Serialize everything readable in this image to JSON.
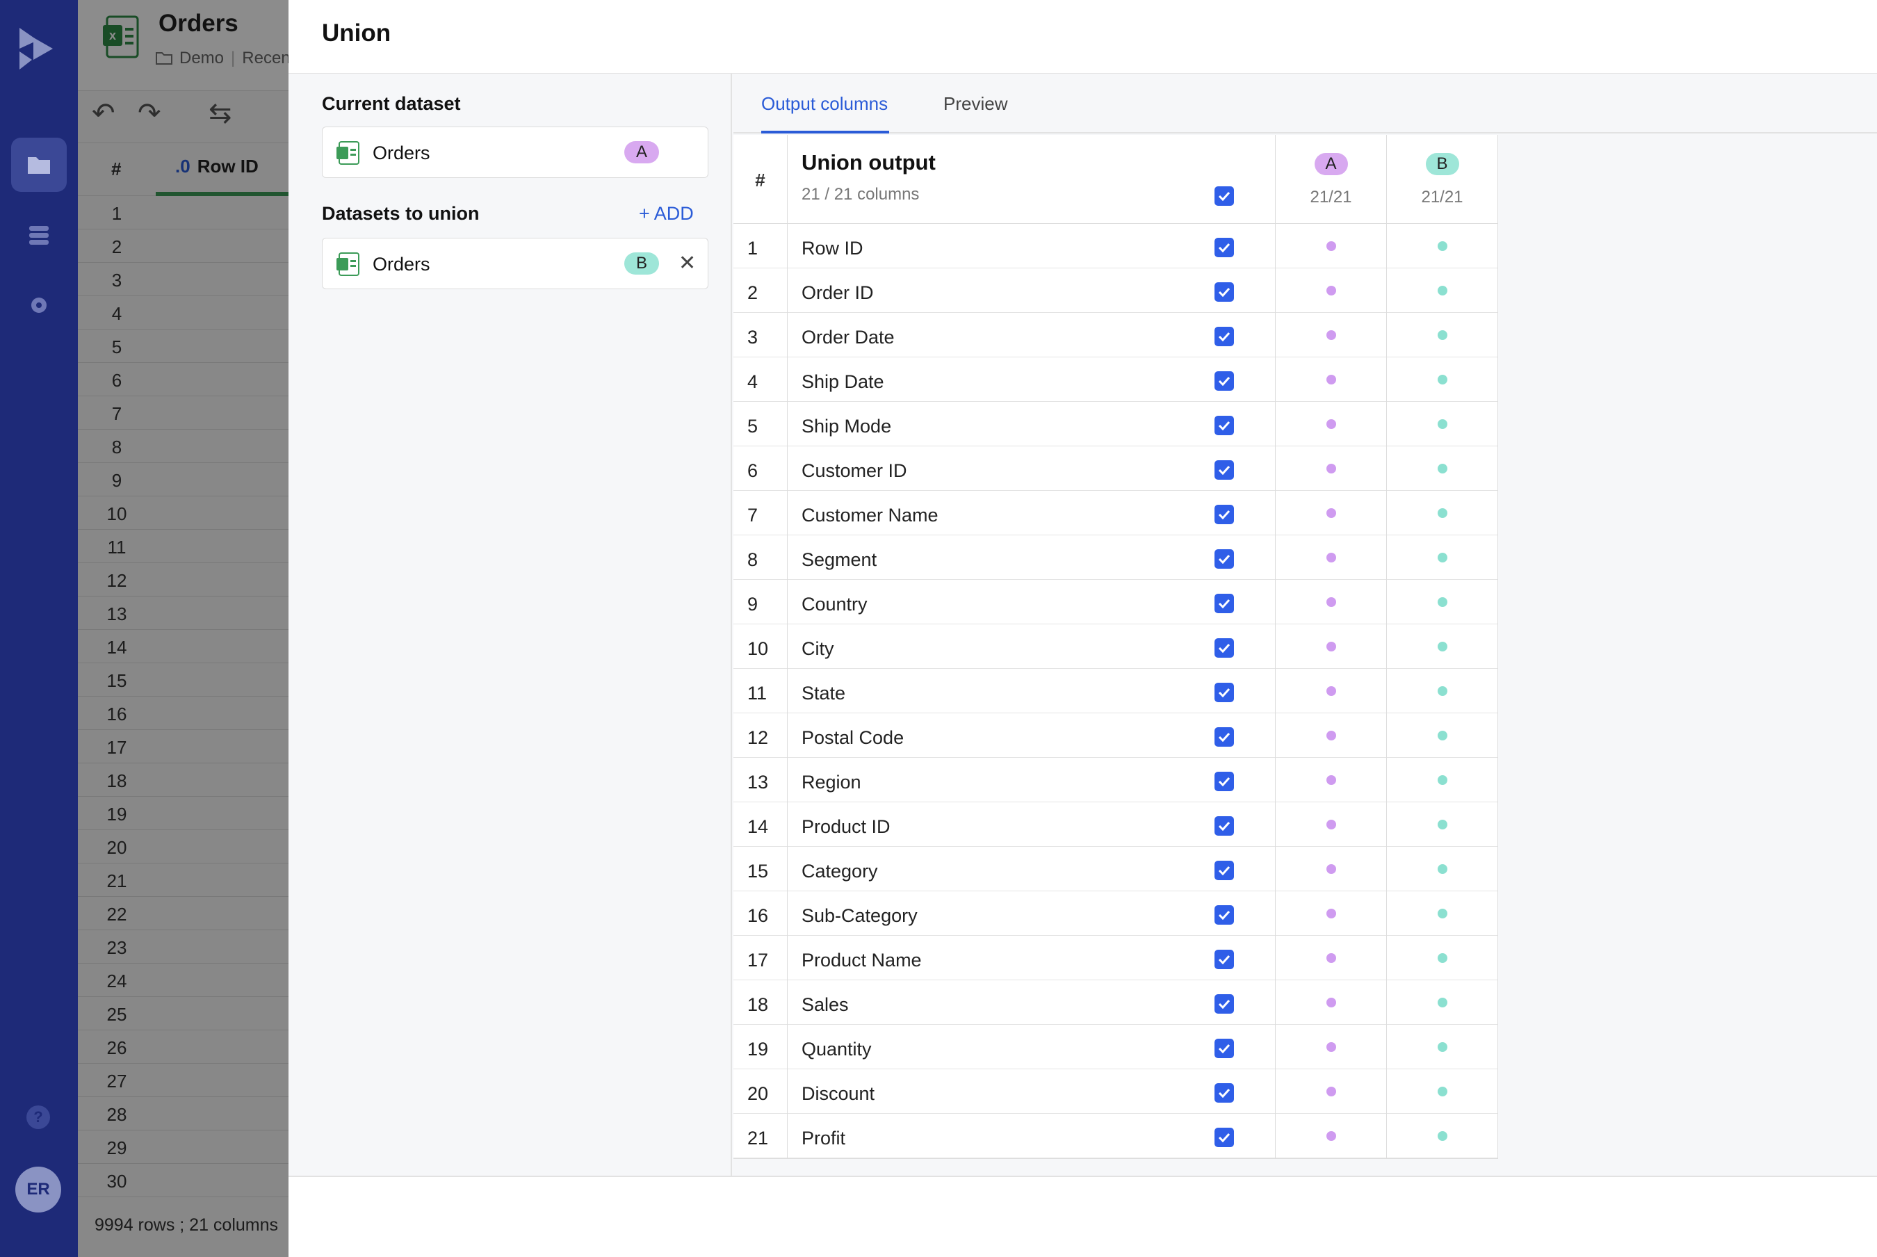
{
  "app": {
    "title": "Orders",
    "breadcrumb_folder": "Demo",
    "breadcrumb_recent": "Recen",
    "grid_first_column": "Row ID",
    "row_numbers": [
      "1",
      "2",
      "3",
      "4",
      "5",
      "6",
      "7",
      "8",
      "9",
      "10",
      "11",
      "12",
      "13",
      "14",
      "15",
      "16",
      "17",
      "18",
      "19",
      "20",
      "21",
      "22",
      "23",
      "24",
      "25",
      "26",
      "27",
      "28",
      "29",
      "30"
    ],
    "status": "9994 rows ; 21 columns",
    "hash": "#"
  },
  "nav": {
    "avatar": "ER",
    "help": "?"
  },
  "modal": {
    "title": "Union",
    "current_dataset_label": "Current dataset",
    "current_dataset": {
      "name": "Orders",
      "badge": "A"
    },
    "datasets_to_union_label": "Datasets to union",
    "add_label": "+ ADD",
    "union_datasets": [
      {
        "name": "Orders",
        "badge": "B"
      }
    ],
    "tabs": [
      {
        "label": "Output columns",
        "active": true
      },
      {
        "label": "Preview",
        "active": false
      }
    ],
    "table": {
      "hash_label": "#",
      "title": "Union output",
      "subtitle": "21 / 21 columns",
      "sources": [
        {
          "badge": "A",
          "count": "21/21",
          "color": "#cf9bf0"
        },
        {
          "badge": "B",
          "count": "21/21",
          "color": "#8be0d0"
        }
      ],
      "columns": [
        {
          "n": "1",
          "name": "Row ID",
          "checked": true
        },
        {
          "n": "2",
          "name": "Order ID",
          "checked": true
        },
        {
          "n": "3",
          "name": "Order Date",
          "checked": true
        },
        {
          "n": "4",
          "name": "Ship Date",
          "checked": true
        },
        {
          "n": "5",
          "name": "Ship Mode",
          "checked": true
        },
        {
          "n": "6",
          "name": "Customer ID",
          "checked": true
        },
        {
          "n": "7",
          "name": "Customer Name",
          "checked": true
        },
        {
          "n": "8",
          "name": "Segment",
          "checked": true
        },
        {
          "n": "9",
          "name": "Country",
          "checked": true
        },
        {
          "n": "10",
          "name": "City",
          "checked": true
        },
        {
          "n": "11",
          "name": "State",
          "checked": true
        },
        {
          "n": "12",
          "name": "Postal Code",
          "checked": true
        },
        {
          "n": "13",
          "name": "Region",
          "checked": true
        },
        {
          "n": "14",
          "name": "Product ID",
          "checked": true
        },
        {
          "n": "15",
          "name": "Category",
          "checked": true
        },
        {
          "n": "16",
          "name": "Sub-Category",
          "checked": true
        },
        {
          "n": "17",
          "name": "Product Name",
          "checked": true
        },
        {
          "n": "18",
          "name": "Sales",
          "checked": true
        },
        {
          "n": "19",
          "name": "Quantity",
          "checked": true
        },
        {
          "n": "20",
          "name": "Discount",
          "checked": true
        },
        {
          "n": "21",
          "name": "Profit",
          "checked": true
        }
      ]
    }
  },
  "colors": {
    "nav_bg": "#1e2a78",
    "accent": "#2a5bd7",
    "checkbox": "#2f5ee8",
    "badge_a": "#d8a9f0",
    "badge_b": "#9ee6d8"
  }
}
